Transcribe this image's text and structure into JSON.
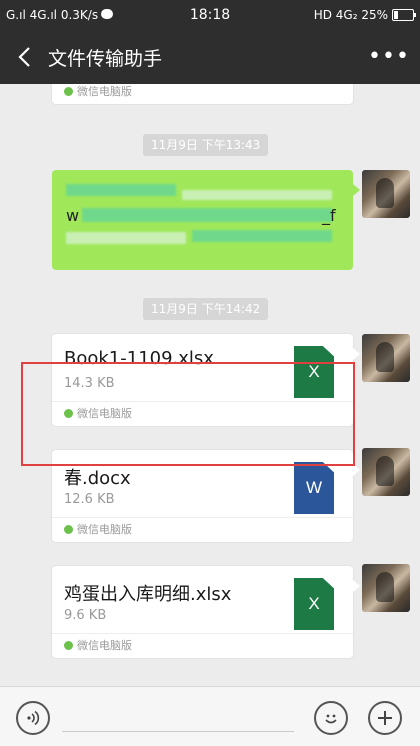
{
  "status": {
    "left": "G.ıl 4G.ıl 0.3K/s",
    "time": "18:18",
    "right": "HD 4G₂ 25%"
  },
  "header": {
    "back_icon": "chevron-left-icon",
    "title": "文件传输助手",
    "more_label": "•••"
  },
  "messages": {
    "top_card_footer": "微信电脑版",
    "ts1": "11月9日 下午13:43",
    "text_fragments": [
      "w",
      "_f"
    ],
    "ts2": "11月9日 下午14:42",
    "files": [
      {
        "name": "Book1-1109.xlsx",
        "size": "14.3 KB",
        "icon_label": "X",
        "icon": "excel-file-icon",
        "color": "#1e7a45",
        "source": "微信电脑版"
      },
      {
        "name": "春.docx",
        "size": "12.6 KB",
        "icon_label": "W",
        "icon": "word-file-icon",
        "color": "#2b579a",
        "source": "微信电脑版"
      },
      {
        "name": "鸡蛋出入库明细.xlsx",
        "size": "9.6 KB",
        "icon_label": "X",
        "icon": "excel-file-icon",
        "color": "#1e7a45",
        "source": "微信电脑版"
      }
    ]
  },
  "bottom": {
    "voice_icon": "voice-icon",
    "emoji_icon": "emoji-icon",
    "plus_icon": "plus-icon"
  },
  "colors": {
    "bar": "#2e2e2e",
    "bubble_green": "#a0e75a",
    "highlight": "#e0403f"
  }
}
